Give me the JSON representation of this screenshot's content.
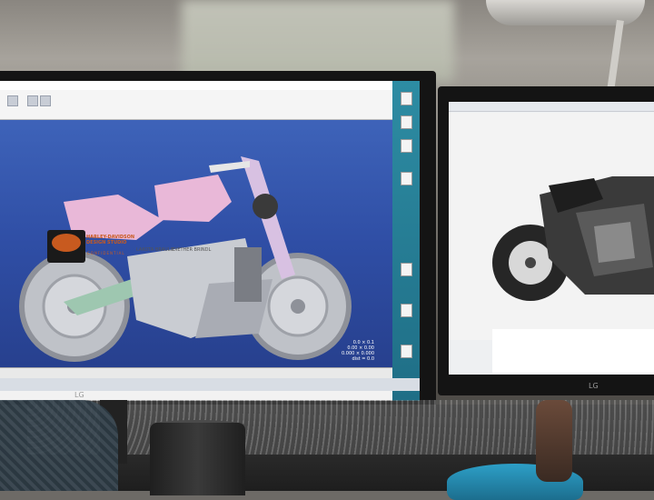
{
  "scene": {
    "description_tag": "photo of design studio desk with two monitors"
  },
  "left_monitor": {
    "brand": "LG",
    "cad_coords": [
      "0.0 × 0.1",
      "0.00 × 0.00",
      "0.000 × 0.000",
      "dist = 0.0"
    ]
  },
  "right_monitor": {
    "brand": "LG",
    "brand_logo_text": "HARLEY-DAVIDSON\nDESIGN STUDIO",
    "confidential": "CONFIDENTIAL",
    "name1": "LAKOTA BRAULIE",
    "name2": "DIETHER BRINDL"
  },
  "colors": {
    "viewport": "#2f4ea5",
    "bike_pink": "#e9b8d8",
    "bike_green": "#9ec7b0",
    "desktop": "#2d8ca3",
    "brand_orange": "#c85a1f"
  }
}
